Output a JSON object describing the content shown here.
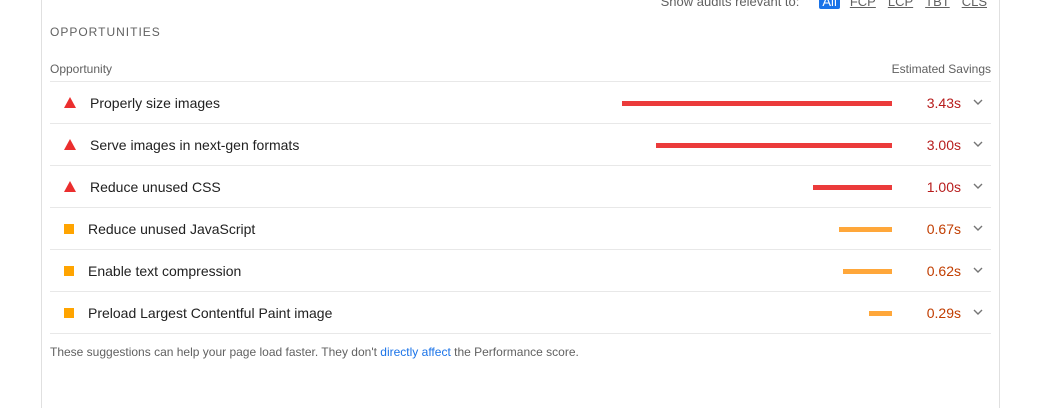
{
  "filter": {
    "label": "Show audits relevant to:",
    "chips": [
      "All",
      "FCP",
      "LCP",
      "TBT",
      "CLS"
    ],
    "active": "All"
  },
  "section": {
    "title": "OPPORTUNITIES"
  },
  "table": {
    "col_opportunity": "Opportunity",
    "col_savings": "Estimated Savings"
  },
  "colors": {
    "fail": "#eb3b3b",
    "warn": "#ffa73a",
    "link": "#1a73e8"
  },
  "opportunities": [
    {
      "title": "Properly size images",
      "savings": "3.43s",
      "severity": "fail",
      "icon": "red-triangle-icon",
      "bar_fraction": 1.0
    },
    {
      "title": "Serve images in next-gen formats",
      "savings": "3.00s",
      "severity": "fail",
      "icon": "red-triangle-icon",
      "bar_fraction": 0.875
    },
    {
      "title": "Reduce unused CSS",
      "savings": "1.00s",
      "severity": "fail",
      "icon": "red-triangle-icon",
      "bar_fraction": 0.292
    },
    {
      "title": "Reduce unused JavaScript",
      "savings": "0.67s",
      "severity": "warn",
      "icon": "orange-square-icon",
      "bar_fraction": 0.195
    },
    {
      "title": "Enable text compression",
      "savings": "0.62s",
      "severity": "warn",
      "icon": "orange-square-icon",
      "bar_fraction": 0.181
    },
    {
      "title": "Preload Largest Contentful Paint image",
      "savings": "0.29s",
      "severity": "warn",
      "icon": "orange-square-icon",
      "bar_fraction": 0.085
    }
  ],
  "footer": {
    "before_link": "These suggestions can help your page load faster. They don't ",
    "link_text": "directly affect",
    "after_link": " the Performance score."
  }
}
